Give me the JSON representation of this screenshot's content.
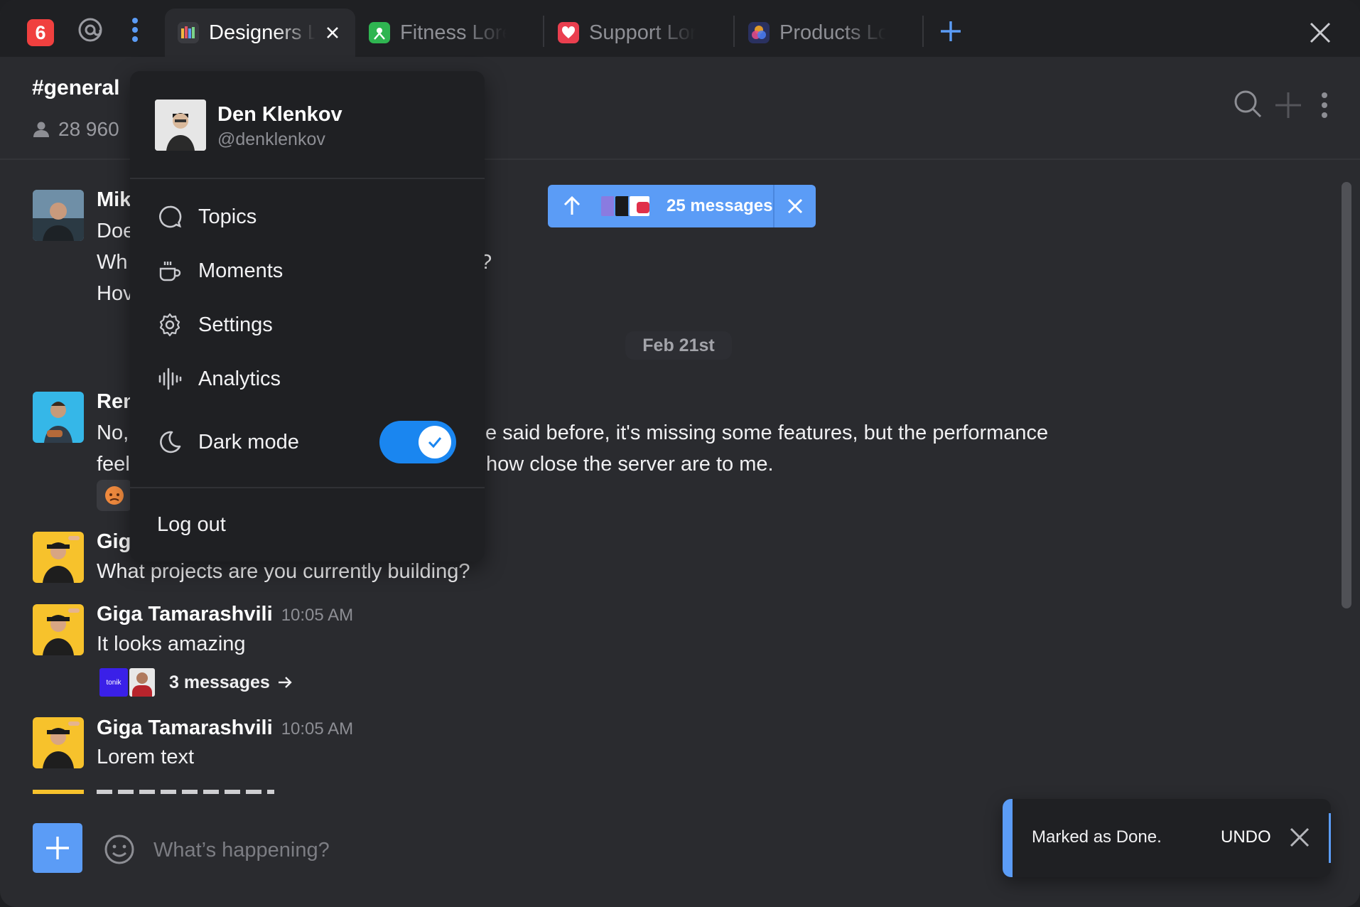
{
  "tabbar": {
    "notification_count": "6",
    "tabs": [
      {
        "label": "Designers Lorem",
        "active": true
      },
      {
        "label": "Fitness Lorem",
        "active": false
      },
      {
        "label": "Support Lorem",
        "active": false
      },
      {
        "label": "Products Lorem",
        "active": false
      }
    ]
  },
  "channel": {
    "name": "#general",
    "members": "28 960"
  },
  "new_messages": {
    "label": "25 messages"
  },
  "date_divider": "Feb 21st",
  "messages": [
    {
      "author": "Mik",
      "lines": [
        "Doe",
        "Wh",
        "Hov"
      ],
      "line_tail": "?"
    },
    {
      "author": "Ren",
      "lines": [
        "No,",
        "feel"
      ],
      "tails": [
        "e said before, it's missing some features, but the performance",
        "how close the server are to me."
      ]
    },
    {
      "author": "Gig",
      "lines": [
        "What projects are you currently building?"
      ]
    },
    {
      "author": "Giga Tamarashvili",
      "time": "10:05 AM",
      "lines": [
        "It looks amazing"
      ],
      "thread": "3 messages",
      "thread_logo": "tonik"
    },
    {
      "author": "Giga Tamarashvili",
      "time": "10:05 AM",
      "lines": [
        "Lorem text"
      ]
    }
  ],
  "menu": {
    "name": "Den Klenkov",
    "handle": "@denklenkov",
    "items": [
      {
        "label": "Topics",
        "icon": "chat-bubble-icon"
      },
      {
        "label": "Moments",
        "icon": "coffee-cup-icon"
      },
      {
        "label": "Settings",
        "icon": "gear-icon"
      },
      {
        "label": "Analytics",
        "icon": "waveform-icon"
      }
    ],
    "dark_mode": {
      "label": "Dark mode",
      "enabled": true
    },
    "logout": "Log out"
  },
  "composer": {
    "placeholder": "What’s happening?"
  },
  "toast": {
    "text": "Marked as Done.",
    "action": "UNDO"
  }
}
